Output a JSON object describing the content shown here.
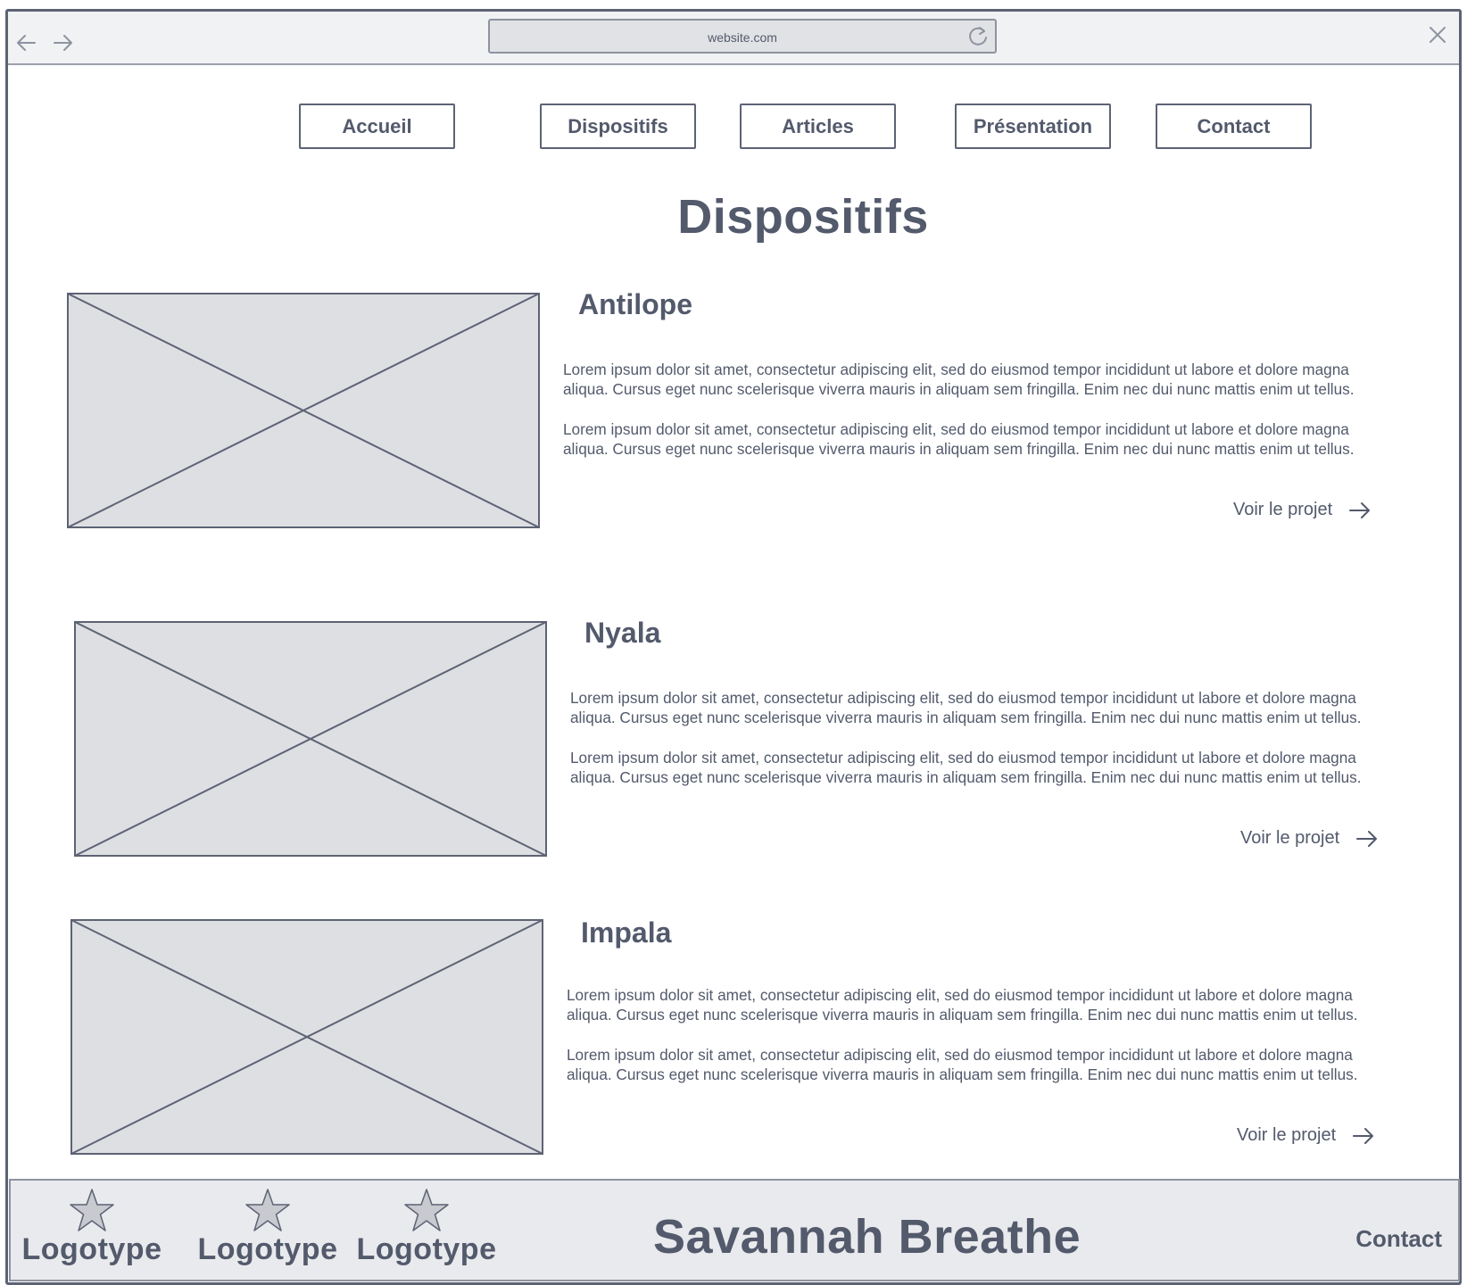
{
  "browser": {
    "url": "website.com"
  },
  "nav": {
    "items": [
      {
        "label": "Accueil"
      },
      {
        "label": "Dispositifs"
      },
      {
        "label": "Articles"
      },
      {
        "label": "Présentation"
      },
      {
        "label": "Contact"
      }
    ]
  },
  "page": {
    "title": "Dispositifs"
  },
  "cards": [
    {
      "title": "Antilope",
      "para1": "Lorem ipsum dolor sit amet, consectetur adipiscing elit, sed do eiusmod tempor incididunt ut labore et dolore magna\naliqua. Cursus eget nunc scelerisque viverra mauris in aliquam sem fringilla. Enim nec dui nunc mattis enim ut tellus.",
      "para2": "Lorem ipsum dolor sit amet, consectetur adipiscing elit, sed do eiusmod tempor incididunt ut labore et dolore magna\naliqua. Cursus eget nunc scelerisque viverra mauris in aliquam sem fringilla. Enim nec dui nunc mattis enim ut tellus.",
      "link": "Voir le projet"
    },
    {
      "title": "Nyala",
      "para1": "Lorem ipsum dolor sit amet, consectetur adipiscing elit, sed do eiusmod tempor incididunt ut labore et dolore magna\naliqua. Cursus eget nunc scelerisque viverra mauris in aliquam sem fringilla. Enim nec dui nunc mattis enim ut tellus.",
      "para2": "Lorem ipsum dolor sit amet, consectetur adipiscing elit, sed do eiusmod tempor incididunt ut labore et dolore magna\naliqua. Cursus eget nunc scelerisque viverra mauris in aliquam sem fringilla. Enim nec dui nunc mattis enim ut tellus.",
      "link": "Voir le projet"
    },
    {
      "title": "Impala",
      "para1": "Lorem ipsum dolor sit amet, consectetur adipiscing elit, sed do eiusmod tempor incididunt ut labore et dolore magna\naliqua. Cursus eget nunc scelerisque viverra mauris in aliquam sem fringilla. Enim nec dui nunc mattis enim ut tellus.",
      "para2": "Lorem ipsum dolor sit amet, consectetur adipiscing elit, sed do eiusmod tempor incididunt ut labore et dolore magna\naliqua. Cursus eget nunc scelerisque viverra mauris in aliquam sem fringilla. Enim nec dui nunc mattis enim ut tellus.",
      "link": "Voir le projet"
    }
  ],
  "footer": {
    "logos": [
      {
        "label": "Logotype",
        "icon": "star-icon"
      },
      {
        "label": "Logotype",
        "icon": "star-icon"
      },
      {
        "label": "Logotype",
        "icon": "star-icon"
      }
    ],
    "brand": "Savannah Breathe",
    "contact": "Contact"
  },
  "colors": {
    "ink": "#535a6c",
    "placeholder_fill": "#dedfe2",
    "footer_bg": "#e9eaed",
    "chrome_bg": "#f1f2f4"
  }
}
